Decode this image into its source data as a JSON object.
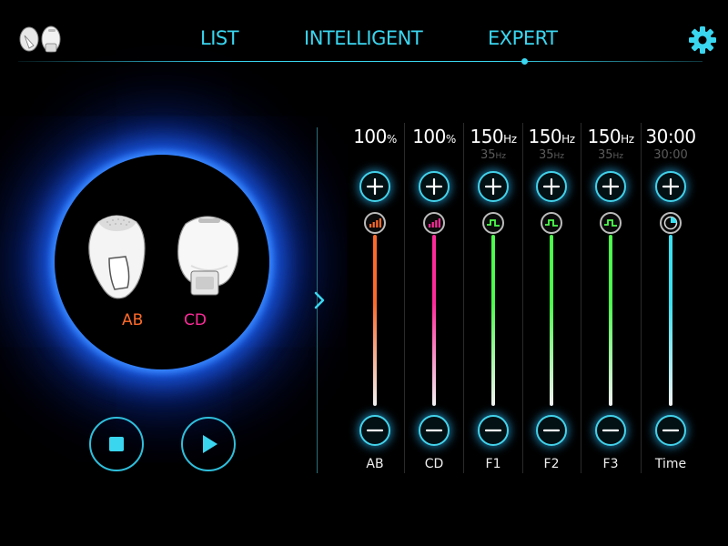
{
  "nav": {
    "tabs": [
      {
        "label": "LIST"
      },
      {
        "label": "INTELLIGENT"
      },
      {
        "label": "EXPERT"
      }
    ],
    "active_tab": "EXPERT",
    "accent": "#3ad6f0"
  },
  "device": {
    "left_label": "AB",
    "right_label": "CD",
    "left_color": "#ff6a2a",
    "right_color": "#ff2a9a"
  },
  "playback": {
    "stop_icon": "stop-icon",
    "play_icon": "play-icon"
  },
  "channels": [
    {
      "label": "AB",
      "value": "100",
      "unit": "%",
      "sub": "",
      "sub_unit": "",
      "color": "#ff6a2a",
      "icon": "signal-bars-icon",
      "level": 1.0
    },
    {
      "label": "CD",
      "value": "100",
      "unit": "%",
      "sub": "",
      "sub_unit": "",
      "color": "#ff2a9a",
      "icon": "signal-bars-icon",
      "level": 1.0
    },
    {
      "label": "F1",
      "value": "150",
      "unit": "Hz",
      "sub": "35",
      "sub_unit": "Hz",
      "color": "#4cff4c",
      "icon": "square-wave-icon",
      "level": 1.0
    },
    {
      "label": "F2",
      "value": "150",
      "unit": "Hz",
      "sub": "35",
      "sub_unit": "Hz",
      "color": "#4cff4c",
      "icon": "square-wave-icon",
      "level": 1.0
    },
    {
      "label": "F3",
      "value": "150",
      "unit": "Hz",
      "sub": "35",
      "sub_unit": "Hz",
      "color": "#4cff4c",
      "icon": "square-wave-icon",
      "level": 1.0
    },
    {
      "label": "Time",
      "value": "30:00",
      "unit": "",
      "sub": "30:00",
      "sub_unit": "",
      "color": "#3ae0f0",
      "icon": "timer-icon",
      "level": 1.0
    }
  ]
}
